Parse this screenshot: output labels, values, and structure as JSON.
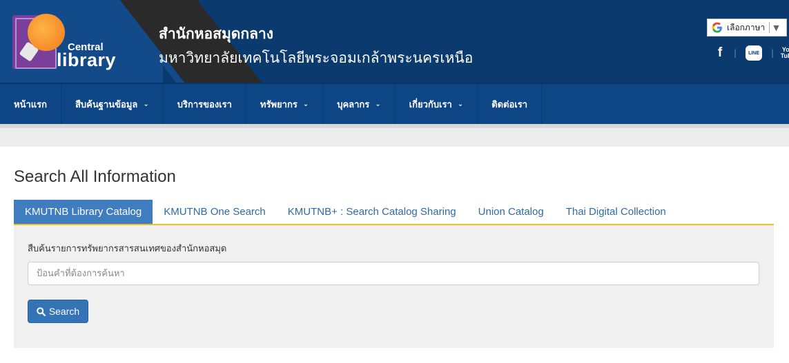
{
  "header": {
    "logo_line1": "Central",
    "logo_line2": "library",
    "title": "สำนักหอสมุดกลาง",
    "subtitle": "มหาวิทยาลัยเทคโนโลยีพระจอมเกล้าพระนครเหนือ",
    "language_select_label": "เลือกภาษา",
    "social_icons": [
      "facebook-icon",
      "line-icon",
      "youtube-icon"
    ],
    "line_icon_text": "LINE",
    "youtube_icon_text": "You Tube"
  },
  "nav": {
    "items": [
      {
        "label": "หน้าแรก",
        "has_dropdown": false
      },
      {
        "label": "สืบค้นฐานข้อมูล",
        "has_dropdown": true
      },
      {
        "label": "บริการของเรา",
        "has_dropdown": false
      },
      {
        "label": "ทรัพยากร",
        "has_dropdown": true
      },
      {
        "label": "บุคลากร",
        "has_dropdown": true
      },
      {
        "label": "เกี่ยวกับเรา",
        "has_dropdown": true
      },
      {
        "label": "ติดต่อเรา",
        "has_dropdown": false
      }
    ]
  },
  "search_section": {
    "title": "Search All Information",
    "tabs": [
      {
        "label": "KMUTNB Library Catalog",
        "active": true
      },
      {
        "label": "KMUTNB One Search",
        "active": false
      },
      {
        "label": "KMUTNB+ : Search Catalog Sharing",
        "active": false
      },
      {
        "label": "Union Catalog",
        "active": false
      },
      {
        "label": "Thai Digital Collection",
        "active": false
      }
    ],
    "panel_label": "สืบค้นรายการทรัพยากรสารสนเทศของสำนักหอสมุด",
    "input_placeholder": "ป้อนคำที่ต้องการค้นหา",
    "input_value": "",
    "search_button_label": "Search"
  },
  "colors": {
    "header_bg": "#0b3a6f",
    "nav_bg": "#0d4585",
    "active_tab_bg": "#3f7cc0",
    "tab_underline": "#f0c21c",
    "button_bg": "#3473b4"
  }
}
